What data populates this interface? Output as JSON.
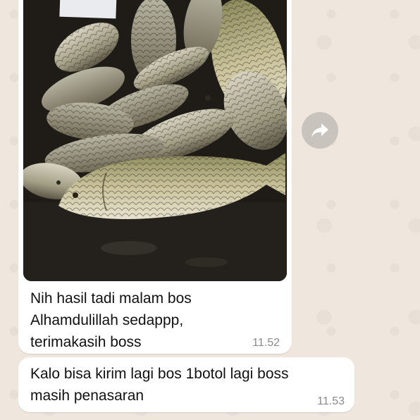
{
  "messages": [
    {
      "type": "image",
      "image_alt": "Photo of caught carp fish",
      "caption_lines": [
        "Nih hasil tadi malam bos",
        "Alhamdulillah sedappp,",
        "terimakasih boss"
      ],
      "time": "11.52"
    },
    {
      "type": "text",
      "lines": [
        "Kalo bisa kirim lagi bos 1botol lagi boss",
        "masih penasaran"
      ],
      "time": "11.53"
    }
  ],
  "forward_button": {
    "icon": "share-forward-icon"
  },
  "colors": {
    "chat_bg": "#efe7dd",
    "bubble": "#ffffff",
    "timestamp": "#8a8a8a",
    "forward_button_bg": "#c8c3bd"
  }
}
